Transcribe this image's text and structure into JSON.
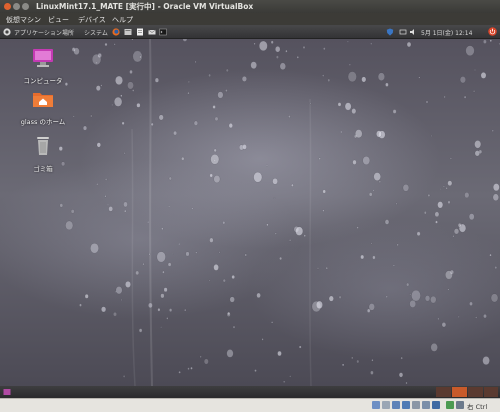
{
  "window": {
    "title": "LinuxMint17.1_MATE [実行中] - Oracle VM VirtualBox"
  },
  "menubar": {
    "items": [
      "仮想マシン",
      "ビュー",
      "デバイス",
      "ヘルプ"
    ]
  },
  "panel": {
    "menus": [
      "アプリケーション",
      "場所",
      "システム"
    ],
    "clock": "5月 1日(金) 12:14"
  },
  "desktop": {
    "icons": [
      {
        "label": "コンピュータ",
        "icon": "computer-icon"
      },
      {
        "label": "glass のホーム",
        "icon": "home-folder-icon"
      },
      {
        "label": "ゴミ箱",
        "icon": "trash-icon"
      }
    ]
  },
  "statusbar": {
    "host_key": "右 Ctrl"
  },
  "colors": {
    "accent": "#e0622f",
    "panel": "#3c3b37",
    "workspace_active": "#c85a2a",
    "workspace": "#5a3a30"
  }
}
